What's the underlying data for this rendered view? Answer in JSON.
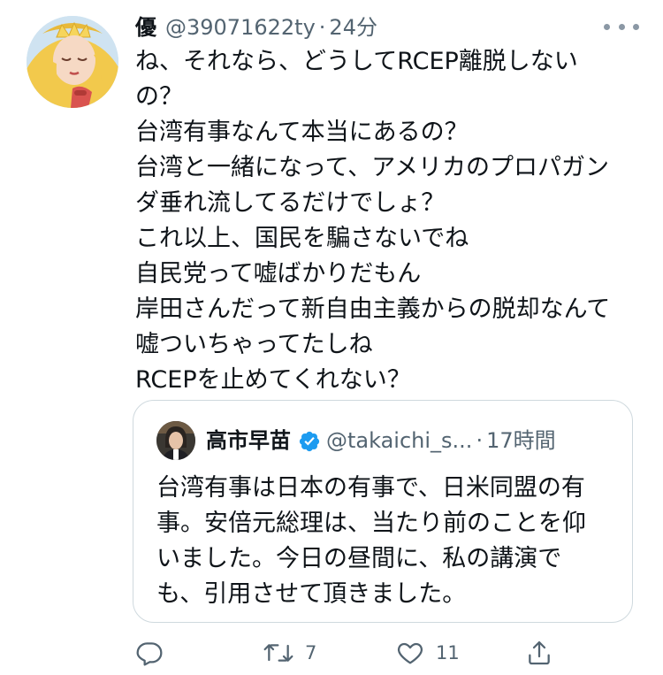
{
  "tweet": {
    "display_name": "優",
    "handle": "@39071622ty",
    "separator": "·",
    "time": "24分",
    "text_lines": [
      "ね、それなら、どうしてRCEP離脱しない",
      "の？",
      "台湾有事なんて本当にあるの？",
      "台湾と一緒になって、アメリカのプロパガン",
      "ダ垂れ流してるだけでしょ？",
      "これ以上、国民を騙さないでね",
      "自民党って嘘ばかりだもん",
      "岸田さんだって新自由主義からの脱却なんて",
      "嘘ついちゃってたしね",
      "RCEPを止めてくれない？"
    ],
    "more_icon": "more-horizontal-icon",
    "avatar": "profile-avatar"
  },
  "quote": {
    "display_name": "高市早苗",
    "verified_icon": "verified-badge-icon",
    "handle": "@takaichi_s...",
    "separator": "·",
    "time": "17時間",
    "text_lines": [
      "台湾有事は日本の有事で、日米同盟の有",
      "事。安倍元総理は、当たり前のことを仰",
      "いました。今日の昼間に、私の講演で",
      "も、引用させて頂きました。"
    ]
  },
  "actions": {
    "reply": {
      "icon": "reply-icon"
    },
    "retweet": {
      "icon": "retweet-icon",
      "count": "7"
    },
    "like": {
      "icon": "heart-icon",
      "count": "11"
    },
    "share": {
      "icon": "share-icon"
    }
  },
  "colors": {
    "text": "#0f1419",
    "secondary": "#536471",
    "border": "#cfd9de",
    "verified": "#1d9bf0"
  }
}
